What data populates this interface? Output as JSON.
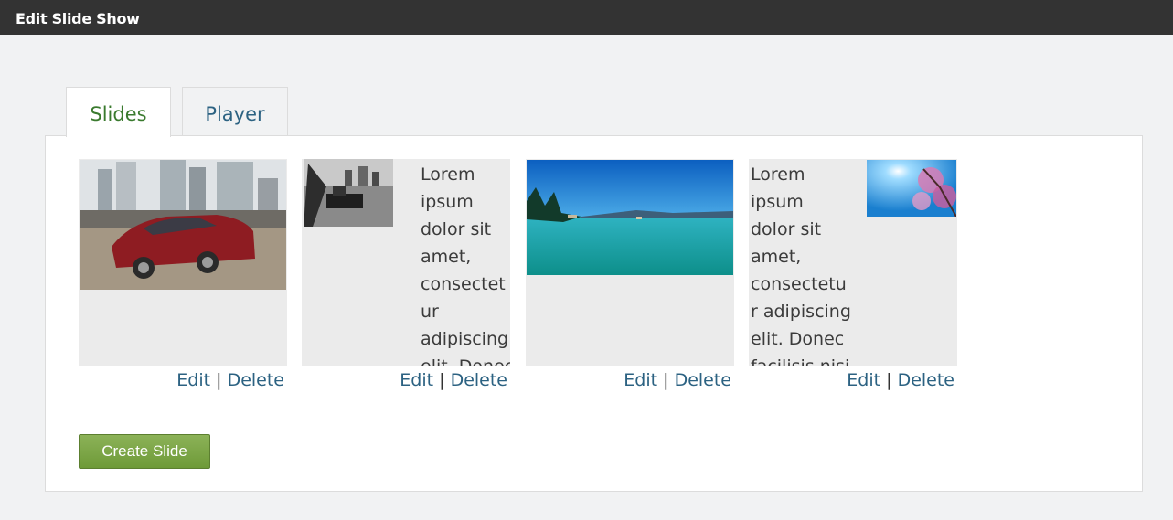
{
  "header": {
    "title": "Edit Slide Show"
  },
  "tabs": [
    {
      "label": "Slides",
      "active": true
    },
    {
      "label": "Player",
      "active": false
    }
  ],
  "slides": [
    {
      "image": "red-car-city-photo",
      "text": ""
    },
    {
      "image": "harbor-boat-bw-photo",
      "text": "Lorem ipsum dolor sit amet, consectetur adipiscing elit. Donec facilisis nisi"
    },
    {
      "image": "lake-trees-photo",
      "text": ""
    },
    {
      "image": "cherry-blossom-sky-photo",
      "text": "Lorem ipsum dolor sit amet, consectetur adipiscing elit. Donec facilisis nisi"
    }
  ],
  "actions": {
    "edit_label": "Edit",
    "separator": "|",
    "delete_label": "Delete"
  },
  "create_button": {
    "label": "Create Slide"
  },
  "colors": {
    "tab_active": "#3a7a2e",
    "link": "#2c6282",
    "button": "#7aa544",
    "titlebar": "#333333"
  }
}
